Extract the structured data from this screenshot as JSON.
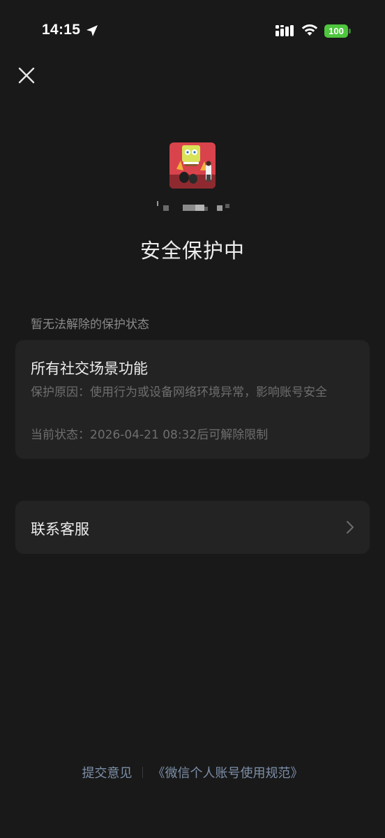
{
  "status_bar": {
    "time": "14:15",
    "battery": "100",
    "icons": [
      "location-arrow-icon",
      "signal-icon",
      "wifi-icon",
      "battery-icon"
    ]
  },
  "header": {
    "close_icon": "close-icon"
  },
  "profile": {
    "avatar": "avatar-image",
    "title": "安全保护中"
  },
  "section": {
    "label": "暂无法解除的保护状态"
  },
  "status_card": {
    "title": "所有社交场景功能",
    "reason": "保护原因：使用行为或设备网络环境异常，影响账号安全",
    "state": "当前状态：2026-04-21 08:32后可解除限制"
  },
  "service": {
    "label": "联系客服",
    "icon": "chevron-right-icon"
  },
  "footer": {
    "feedback": "提交意见",
    "policy": "《微信个人账号使用规范》"
  },
  "colors": {
    "background": "#191919",
    "card": "#232323",
    "link": "#7d90a9",
    "battery": "#4ec63e"
  }
}
